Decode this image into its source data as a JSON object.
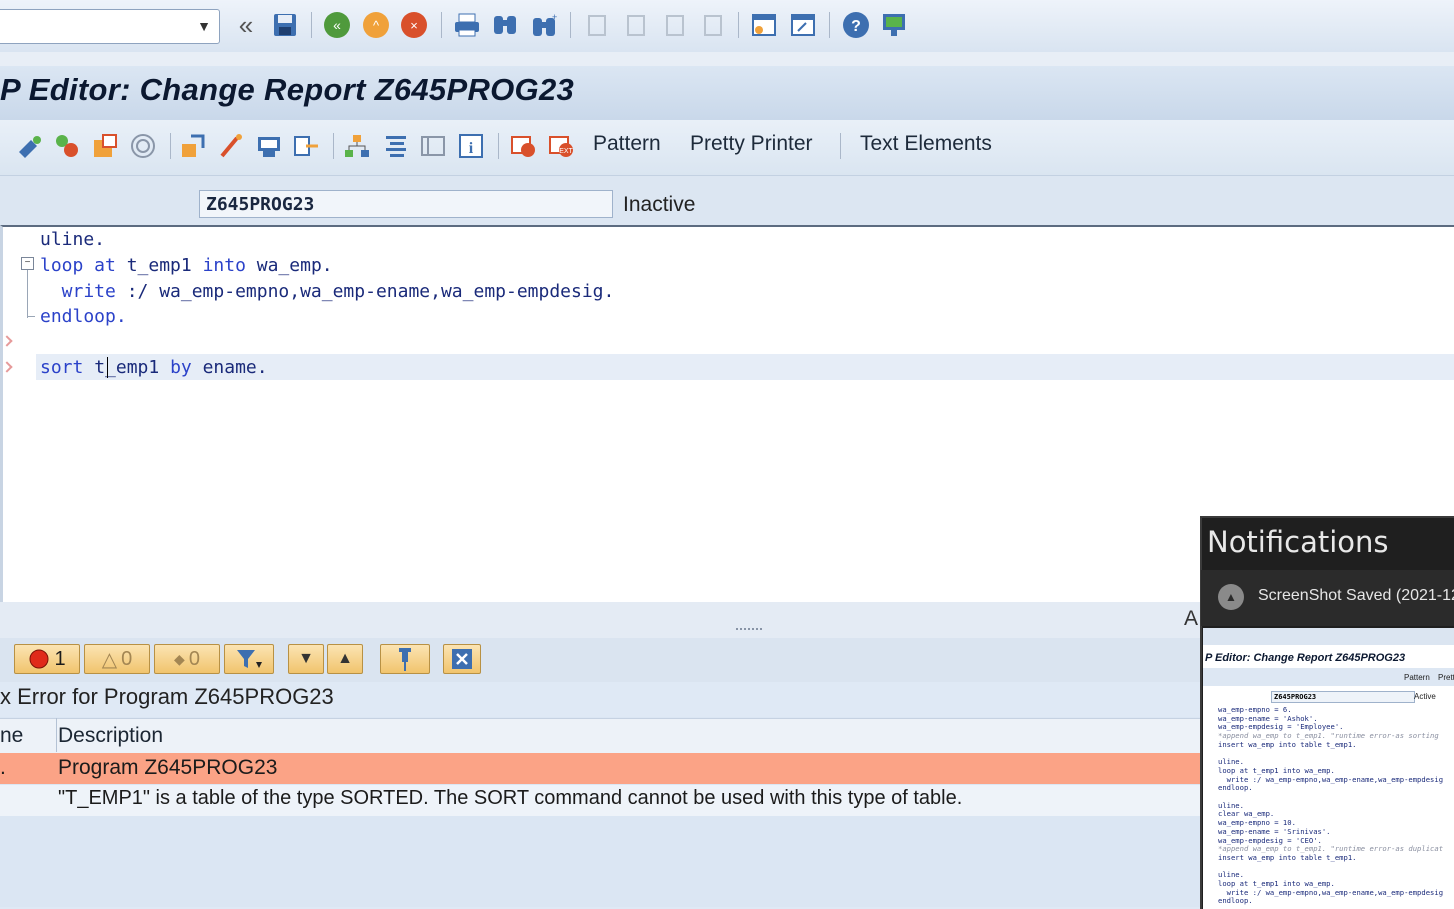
{
  "window": {
    "title": "P Editor: Change Report Z645PROG23"
  },
  "system_toolbar": {
    "icons": [
      "chevron-down-icon",
      "double-left-icon",
      "save-icon",
      "back-icon",
      "exit-icon",
      "cancel-icon",
      "print-icon",
      "find-icon",
      "find-next-icon",
      "first-page-icon",
      "prev-page-icon",
      "next-page-icon",
      "last-page-icon",
      "new-session-icon",
      "shortcut-icon",
      "help-icon",
      "customize-layout-icon"
    ]
  },
  "app_toolbar": {
    "buttons": {
      "pattern": "Pattern",
      "pretty_printer": "Pretty Printer",
      "text_elements": "Text Elements"
    }
  },
  "program": {
    "name": "Z645PROG23",
    "status": "Inactive"
  },
  "editor": {
    "lines": [
      {
        "kw": "",
        "text": "uline."
      },
      {
        "kw": "loop at",
        "text": " t_emp1 ",
        "kw2": "into",
        "text2": " wa_emp."
      },
      {
        "kw": "  write",
        "text": " :/ wa_emp-empno,wa_emp-ename,wa_emp-empdesig."
      },
      {
        "kw": "endloop.",
        "text": ""
      },
      {
        "kw": "",
        "text": ""
      },
      {
        "kw": "sort",
        "text": " t_emp1 ",
        "kw2": "by",
        "text2": " ename."
      }
    ]
  },
  "error_toolbar": {
    "errors_count": "1",
    "warnings_count": "0",
    "info_count": "0",
    "right_marker": "A"
  },
  "error_list": {
    "title": "x Error for Program Z645PROG23",
    "columns": [
      "ne",
      "Description"
    ],
    "rows": [
      {
        "col1": ".",
        "description": "Program Z645PROG23"
      },
      {
        "col1": "",
        "description": "\"T_EMP1\" is a table of the type SORTED. The SORT command cannot be used with this type of table."
      }
    ]
  },
  "notifications": {
    "header": "Notifications",
    "item_text": "ScreenShot Saved    (2021-12-",
    "thumbnail": {
      "title": "P Editor: Change Report Z645PROG23",
      "pattern": "Pattern",
      "pretty": "Prett",
      "program": "Z645PROG23",
      "status": "Active",
      "code": [
        "wa_emp-empno = 6.",
        "wa_emp-ename = 'Ashok'.",
        "wa_emp-empdesig = 'Employee'.",
        "*append wa_emp to t_emp1. \"runtime error-as sorting",
        "insert wa_emp into table t_emp1.",
        "",
        "uline.",
        "loop at t_emp1 into wa_emp.",
        "  write :/ wa_emp-empno,wa_emp-ename,wa_emp-empdesig",
        "endloop.",
        "",
        "uline.",
        "clear wa_emp.",
        "wa_emp-empno = 10.",
        "wa_emp-ename = 'Srinivas'.",
        "wa_emp-empdesig = 'CEO'.",
        "*append wa_emp to t_emp1. \"runtime error-as duplicat",
        "insert wa_emp into table t_emp1.",
        "",
        "uline.",
        "loop at t_emp1 into wa_emp.",
        "  write :/ wa_emp-empno,wa_emp-ename,wa_emp-empdesig",
        "endloop."
      ]
    }
  }
}
